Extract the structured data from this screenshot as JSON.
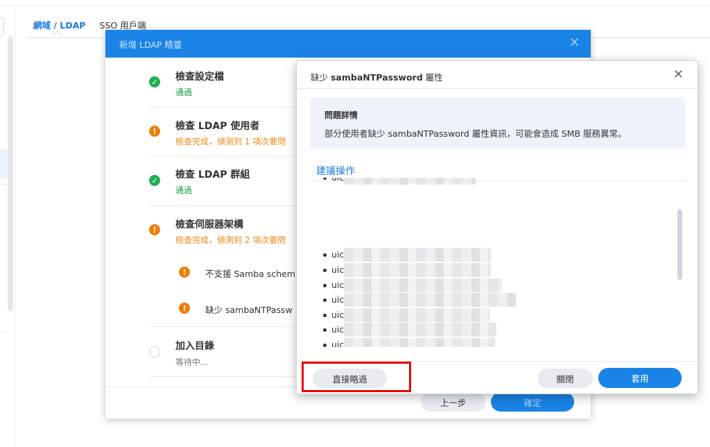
{
  "background": {
    "tabs": [
      {
        "label": "網域 / LDAP",
        "active": true
      },
      {
        "label": "SSO 用戶端",
        "active": false
      }
    ]
  },
  "wizard": {
    "title": "新增 LDAP 精靈",
    "steps": [
      {
        "title": "檢查設定檔",
        "status": "通過",
        "state": "ok"
      },
      {
        "title": "檢查 LDAP 使用者",
        "status": "檢查完成，偵測到 1 項次要問",
        "state": "warn"
      },
      {
        "title": "檢查 LDAP 群組",
        "status": "通過",
        "state": "ok"
      },
      {
        "title": "檢查伺服器架構",
        "status": "檢查完成，偵測到 2 項次要問",
        "state": "warn"
      },
      {
        "title": "加入目錄",
        "status": "等待中...",
        "state": "pending"
      }
    ],
    "substeps": [
      {
        "label": "不支援 Samba schem"
      },
      {
        "label": "缺少 sambaNTPassw"
      }
    ],
    "buttons": {
      "prev": "上一步",
      "confirm": "確定"
    }
  },
  "dialog": {
    "title_prefix": "缺少 ",
    "title_attr": "sambaNTPassword",
    "title_suffix": " 屬性",
    "problem": {
      "heading": "問題詳情",
      "detail": "部分使用者缺少 sambaNTPassword 屬性資訊，可能會造成 SMB 服務異常。"
    },
    "suggestion_heading": "建議操作",
    "list_items": [
      "uic",
      "uic",
      "uic",
      "uic",
      "uic",
      "uic",
      "uic",
      "uic",
      "uic",
      "uic",
      "uic"
    ],
    "buttons": {
      "skip": "直接略過",
      "close": "關閉",
      "apply": "套用"
    }
  },
  "colors": {
    "accent": "#1a84e6",
    "success": "#1fb055",
    "warning": "#f07e0a",
    "highlight_box": "#e60000"
  },
  "icons": {
    "close": "close-icon",
    "success": "check-circle-icon",
    "warning": "exclamation-circle-icon",
    "pending": "empty-circle-icon"
  }
}
